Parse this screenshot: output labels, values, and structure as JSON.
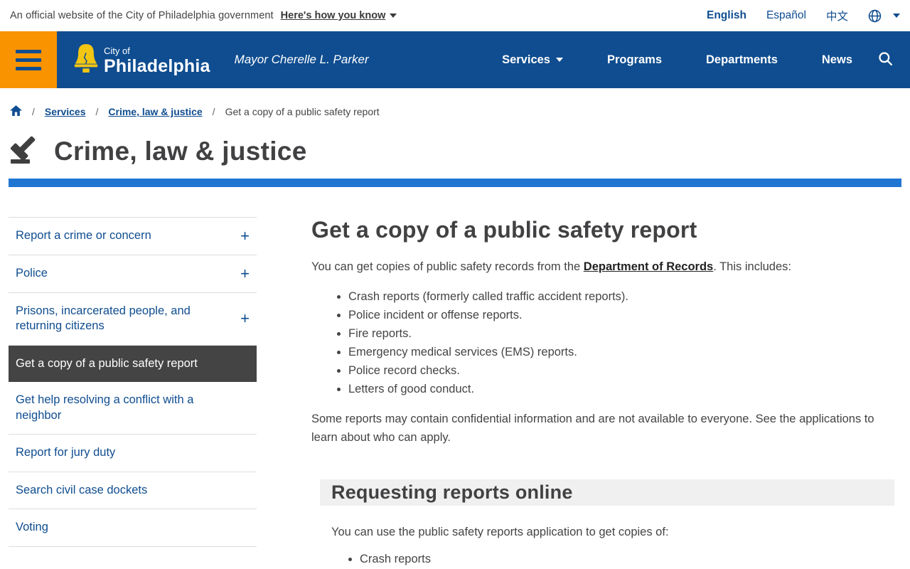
{
  "colors": {
    "brand_blue": "#0f4d90",
    "accent_blue": "#2176d2",
    "brand_orange": "#f99300",
    "active_item_gray": "#444444",
    "bell_yellow": "#f3c613"
  },
  "banner": {
    "official_text": "An official website of the City of Philadelphia government",
    "how_you_know": "Here's how you know",
    "languages": [
      "English",
      "Español",
      "中文"
    ]
  },
  "nav": {
    "logo_line1": "City of",
    "logo_line2": "Philadelphia",
    "mayor": "Mayor Cherelle L. Parker",
    "items": [
      "Services",
      "Programs",
      "Departments",
      "News"
    ]
  },
  "breadcrumb": {
    "separator": "/",
    "links": [
      "Services",
      "Crime, law & justice"
    ],
    "current": "Get a copy of a public safety report"
  },
  "page": {
    "title": "Crime, law & justice"
  },
  "sidebar": {
    "items": [
      {
        "label": "Report a crime or concern"
      },
      {
        "label": "Police"
      },
      {
        "label": "Prisons, incarcerated people, and returning citizens"
      },
      {
        "label": "Get a copy of a public safety report"
      },
      {
        "label": "Get help resolving a conflict with a neighbor"
      },
      {
        "label": "Report for jury duty"
      },
      {
        "label": "Search civil case dockets"
      },
      {
        "label": "Voting"
      }
    ]
  },
  "content": {
    "heading": "Get a copy of a public safety report",
    "intro_before": "You can get copies of public safety records from the ",
    "intro_link": "Department of Records",
    "intro_after": ". This includes:",
    "bullets": [
      "Crash reports (formerly called traffic accident reports).",
      "Police incident or offense reports.",
      "Fire reports.",
      "Emergency medical services (EMS) reports.",
      "Police record checks.",
      "Letters of good conduct."
    ],
    "note": "Some reports may contain confidential information and are not available to everyone. See the applications to learn about who can apply.",
    "section": {
      "title": "Requesting reports online",
      "intro": "You can use the public safety reports application to get copies of:",
      "bullets": [
        "Crash reports"
      ]
    }
  },
  "icons": {
    "plus": "+"
  }
}
